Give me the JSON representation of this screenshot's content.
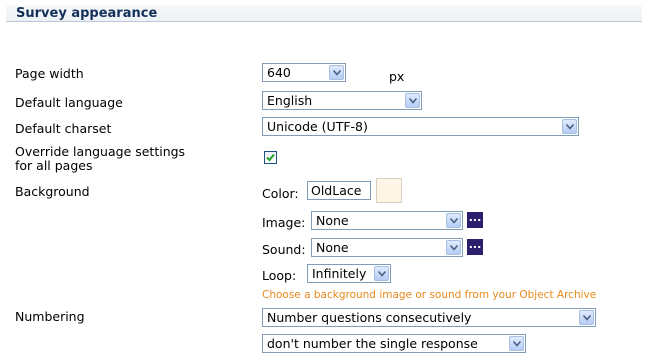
{
  "section": {
    "title": "Survey appearance"
  },
  "page_width": {
    "label": "Page width",
    "value": "640",
    "unit": "px"
  },
  "default_language": {
    "label": "Default language",
    "value": "English"
  },
  "default_charset": {
    "label": "Default charset",
    "value": "Unicode (UTF-8)"
  },
  "override": {
    "label_line1": "Override language settings",
    "label_line2": "for all pages",
    "checked": true
  },
  "background": {
    "label": "Background",
    "color_label": "Color:",
    "color_value": "OldLace",
    "color_hex": "#fdf5e6",
    "image_label": "Image:",
    "image_value": "None",
    "sound_label": "Sound:",
    "sound_value": "None",
    "browse_label": "...",
    "loop_label": "Loop:",
    "loop_value": "Infinitely",
    "hint": "Choose a background image or sound from your Object Archive"
  },
  "numbering": {
    "label": "Numbering",
    "mode_value": "Number questions consecutively",
    "single_value": "don't number the single response"
  },
  "colors": {
    "hint_orange": "#e88a1a",
    "browse_purple": "#2a1f6c",
    "header_text": "#14305a"
  },
  "icons": [
    "chevron-down-icon",
    "checkmark-icon",
    "ellipsis-icon"
  ]
}
